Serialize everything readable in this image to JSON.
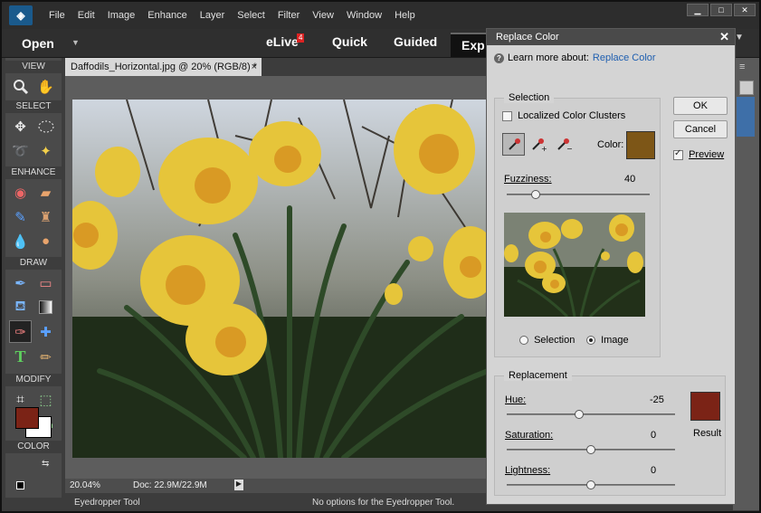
{
  "menubar": {
    "items": [
      "File",
      "Edit",
      "Image",
      "Enhance",
      "Layer",
      "Select",
      "Filter",
      "View",
      "Window",
      "Help"
    ],
    "window_buttons": [
      "▁",
      "□",
      "✕"
    ]
  },
  "modebar": {
    "open_label": "Open",
    "elive_label": "eLive",
    "elive_badge": "4",
    "quick_label": "Quick",
    "guided_label": "Guided",
    "expert_label": "Exp"
  },
  "toolbox": {
    "sections": [
      "VIEW",
      "SELECT",
      "ENHANCE",
      "DRAW",
      "MODIFY",
      "COLOR"
    ],
    "foreground_color": "#7b2316",
    "background_color": "#ffffff"
  },
  "document": {
    "tab_title": "Daffodils_Horizontal.jpg @ 20% (RGB/8) *",
    "close_glyph": "×",
    "zoom": "20.04%",
    "doc_size": "Doc: 22.9M/22.9M"
  },
  "options_bar": {
    "tool_name": "Eyedropper Tool",
    "message": "No options for the Eyedropper Tool."
  },
  "dialog": {
    "title": "Replace Color",
    "close_glyph": "✕",
    "learn_prefix": "Learn more about:",
    "learn_link": "Replace Color",
    "ok_label": "OK",
    "cancel_label": "Cancel",
    "preview_label": "Preview",
    "preview_checked": true,
    "selection": {
      "group_label": "Selection",
      "localized_label": "Localized Color Clusters",
      "localized_checked": false,
      "color_label": "Color:",
      "color": "#7d5617",
      "fuzziness_label": "Fuzziness:",
      "fuzziness_value": "40",
      "fuzziness_fraction": 0.2,
      "radio_selection_label": "Selection",
      "radio_image_label": "Image",
      "radio_selected": "image"
    },
    "replacement": {
      "group_label": "Replacement",
      "hue_label": "Hue:",
      "hue_value": "-25",
      "hue_fraction": 0.43,
      "saturation_label": "Saturation:",
      "saturation_value": "0",
      "saturation_fraction": 0.5,
      "lightness_label": "Lightness:",
      "lightness_value": "0",
      "lightness_fraction": 0.5,
      "result_label": "Result",
      "result_color": "#7b2316"
    }
  },
  "icons": {
    "zoom": "magnifier-icon",
    "hand": "hand-icon",
    "move": "move-icon",
    "marquee": "marquee-icon",
    "lasso": "lasso-icon",
    "magic": "magic-wand-icon"
  }
}
